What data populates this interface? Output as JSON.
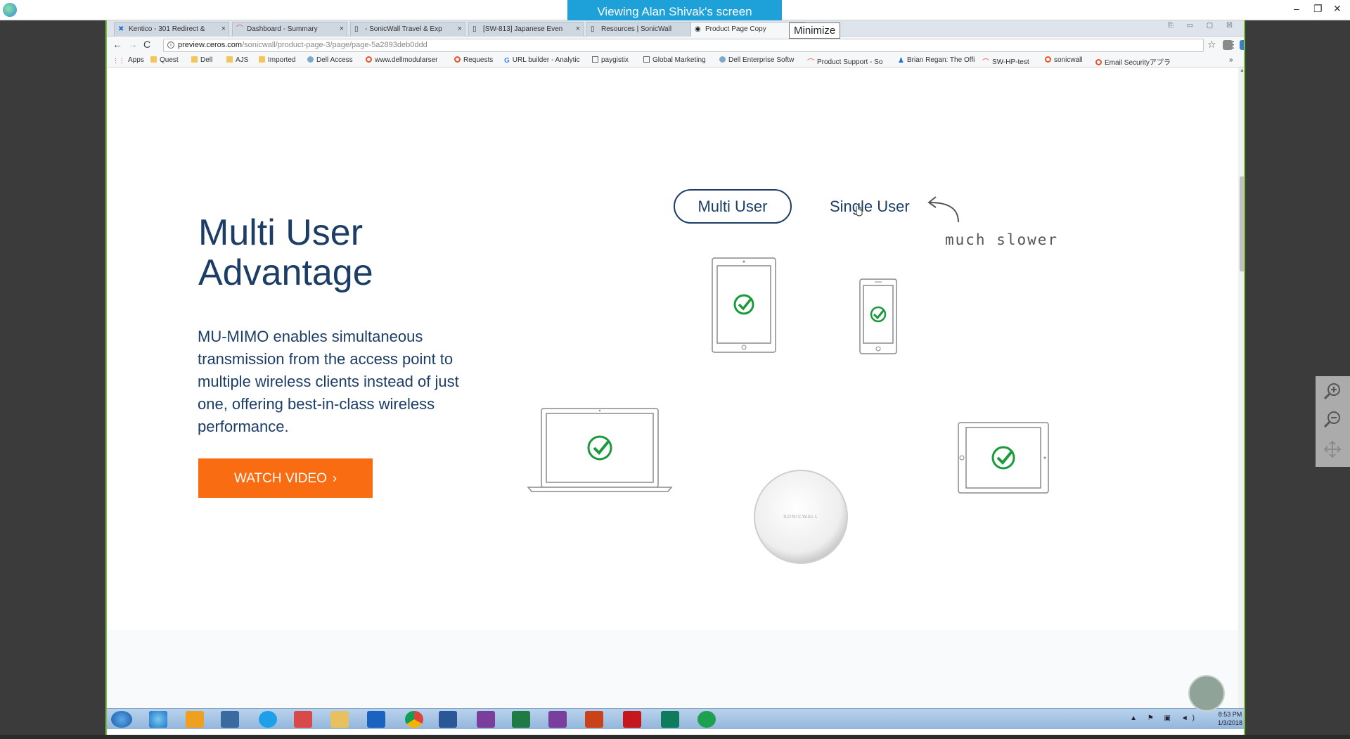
{
  "viewer": {
    "banner": "Viewing Alan Shivak's screen",
    "minimize_tooltip": "Minimize",
    "min_glyph": "–",
    "max_glyph": "❐",
    "close_glyph": "✕"
  },
  "tabs": [
    {
      "label": "Kentico - 301 Redirect &",
      "icon": "x-icon"
    },
    {
      "label": "Dashboard - Summary",
      "icon": "swoosh-icon"
    },
    {
      "label": "- SonicWall Travel & Exp",
      "icon": "page-icon"
    },
    {
      "label": "[SW-813] Japanese Even",
      "icon": "page-icon"
    },
    {
      "label": "Resources | SonicWall",
      "icon": "page-icon"
    },
    {
      "label": "Product Page Copy",
      "icon": "ceros-icon",
      "active": true
    }
  ],
  "address": {
    "host": "preview.ceros.com",
    "path": "/sonicwall/product-page-3/page/page-5a2893deb0ddd"
  },
  "bookmarks": [
    {
      "label": "Apps",
      "icon": "apps"
    },
    {
      "label": "Quest",
      "icon": "folder"
    },
    {
      "label": "Dell",
      "icon": "folder"
    },
    {
      "label": "AJS",
      "icon": "folder"
    },
    {
      "label": "Imported",
      "icon": "folder"
    },
    {
      "label": "Dell Access",
      "icon": "globe"
    },
    {
      "label": "www.dellmodularser",
      "icon": "ring"
    },
    {
      "label": "Requests",
      "icon": "ring"
    },
    {
      "label": "URL builder - Analytic",
      "icon": "google"
    },
    {
      "label": "paygistix",
      "icon": "page"
    },
    {
      "label": "Global Marketing",
      "icon": "page"
    },
    {
      "label": "Dell Enterprise Softw",
      "icon": "globe"
    },
    {
      "label": "Product Support - So",
      "icon": "swoosh"
    },
    {
      "label": "Brian Regan: The Offi",
      "icon": "person"
    },
    {
      "label": "SW-HP-test",
      "icon": "swoosh"
    },
    {
      "label": "sonicwall",
      "icon": "ring"
    },
    {
      "label": "Email Securityアプラ",
      "icon": "ring"
    }
  ],
  "content": {
    "heading_line1": "Multi User",
    "heading_line2": "Advantage",
    "description": "MU-MIMO enables simultaneous transmission from the access point to multiple wireless clients instead of just one, offering best-in-class wireless performance.",
    "watch_button": "WATCH VIDEO",
    "toggle_multi": "Multi User",
    "toggle_single": "Single User",
    "annotation": "much slower",
    "access_point_brand": "SONICWALL"
  },
  "colors": {
    "navy": "#1c3d66",
    "orange": "#fa6c12",
    "check_green": "#1a9a3a",
    "banner_blue": "#1ea0d8"
  },
  "taskbar": {
    "time": "8:53 PM",
    "date": "1/3/2018",
    "apps": [
      "start",
      "ie",
      "media",
      "network",
      "skype",
      "snip",
      "explorer",
      "outlook",
      "chrome",
      "word",
      "onenote-n",
      "excel",
      "onenote",
      "powerpoint",
      "acrobat",
      "sway",
      "remote"
    ]
  },
  "ui_glyphs": {
    "tab_close": "×",
    "back": "←",
    "forward": "→",
    "reload": "C",
    "info": "i",
    "star": "☆",
    "chevron_right": "›",
    "more": "»",
    "menu": "⋮",
    "win_controls": "⎘ ▭ ▢ ☒",
    "tray_icons": "▲ ⚑ ▣ ◄)",
    "scroll_up": "▲",
    "scroll_down": "▼"
  }
}
